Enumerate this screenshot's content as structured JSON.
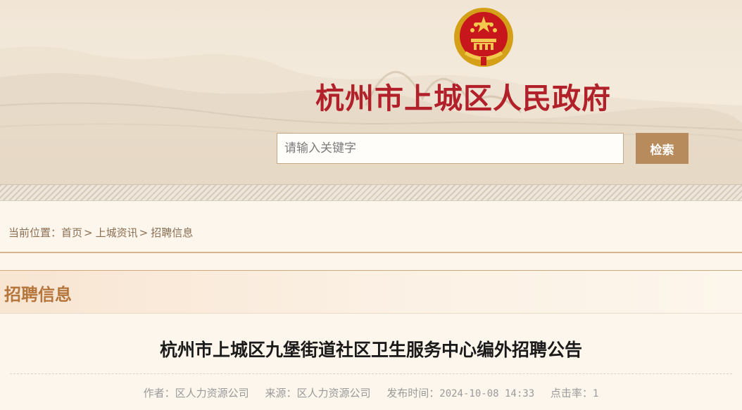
{
  "header": {
    "site_title": "杭州市上城区人民政府",
    "emblem_icon": "national-emblem-icon",
    "search": {
      "placeholder": "请输入关键字",
      "value": "",
      "button_label": "检索"
    }
  },
  "breadcrumb": {
    "prefix": "当前位置：",
    "items": [
      "首页",
      "上城资讯",
      "招聘信息"
    ],
    "separator": ">"
  },
  "section": {
    "title": "招聘信息"
  },
  "article": {
    "title": "杭州市上城区九堡街道社区卫生服务中心编外招聘公告",
    "meta": {
      "author_label": "作者：",
      "author": "区人力资源公司",
      "source_label": "来源：",
      "source": "区人力资源公司",
      "time_label": "发布时间：",
      "time": "2024-10-08 14:33",
      "clicks_label": "点击率：",
      "clicks": "1"
    }
  },
  "colors": {
    "title_red": "#b2202a",
    "accent_brown": "#b88b5d",
    "section_title": "#b5763c",
    "breadcrumb_text": "#8a6e52"
  }
}
